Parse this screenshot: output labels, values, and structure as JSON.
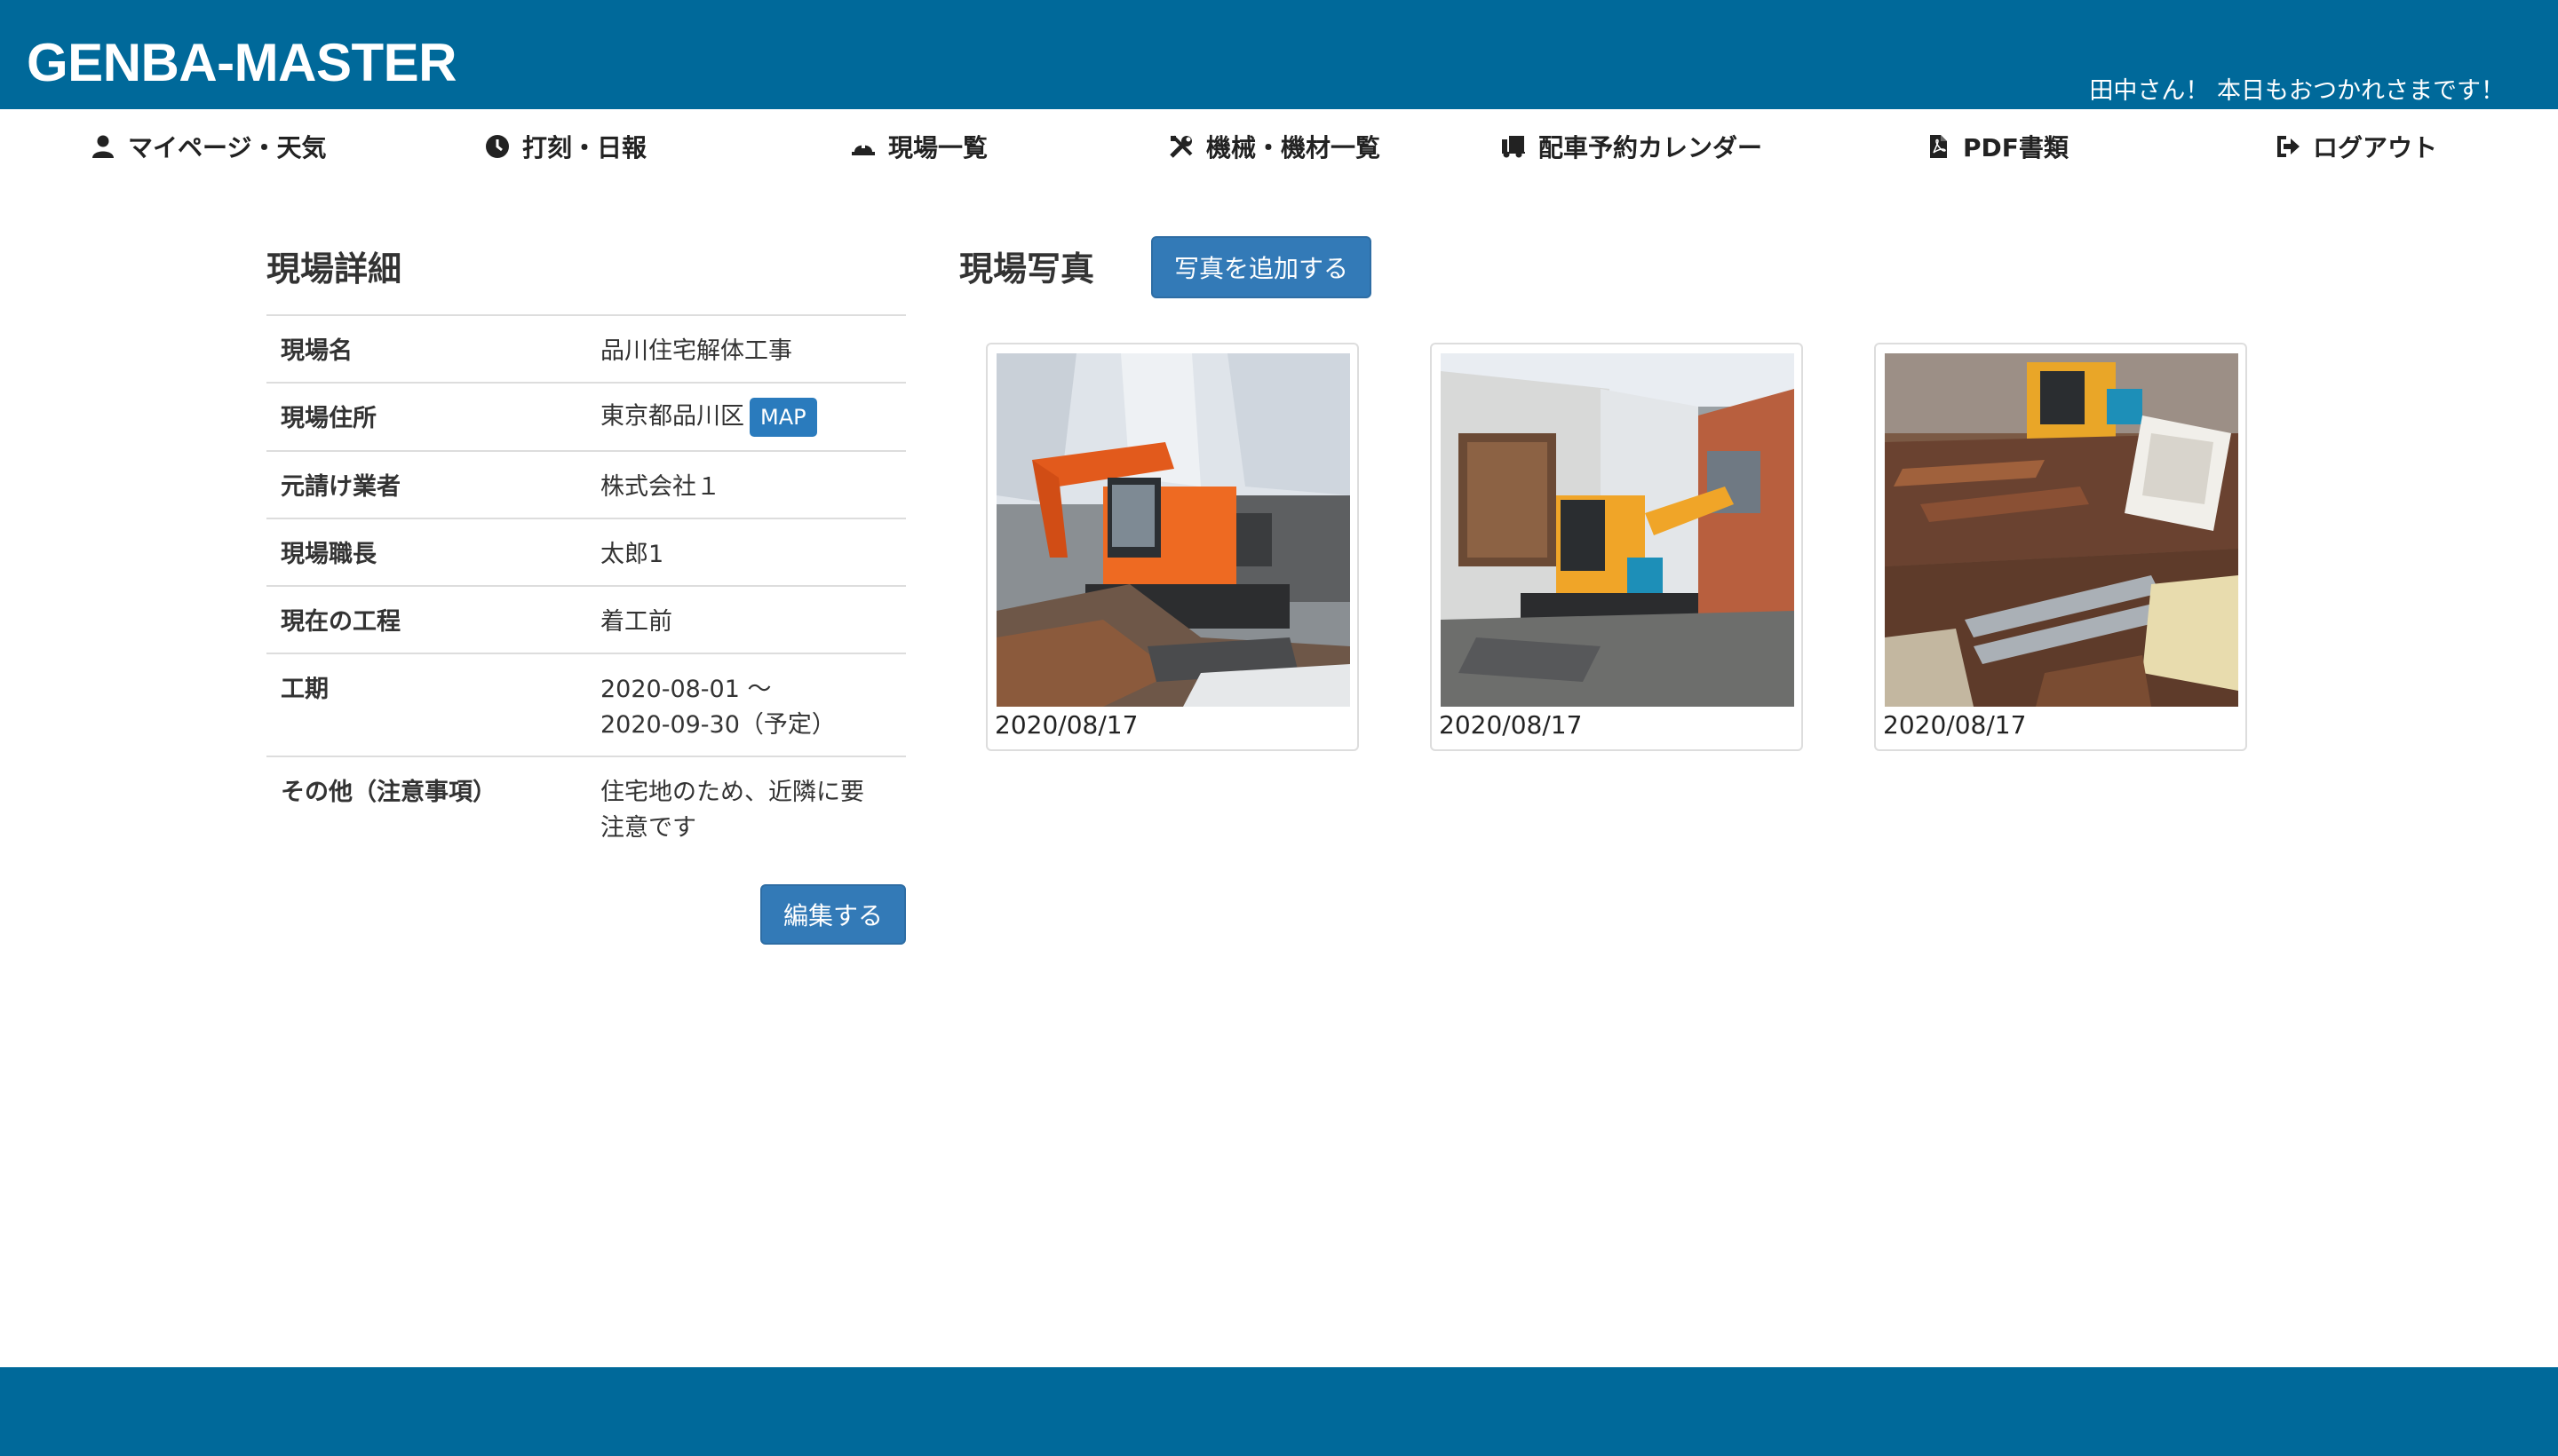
{
  "app": {
    "brand": "GENBA-MASTER",
    "greeting": "田中さん！ 本日もおつかれさまです！"
  },
  "nav": {
    "items": [
      {
        "label": "マイページ・天気",
        "icon": "user-icon"
      },
      {
        "label": "打刻・日報",
        "icon": "clock-icon"
      },
      {
        "label": "現場一覧",
        "icon": "hardhat-icon"
      },
      {
        "label": "機械・機材一覧",
        "icon": "tools-icon"
      },
      {
        "label": "配車予約カレンダー",
        "icon": "truck-icon"
      },
      {
        "label": "PDF書類",
        "icon": "pdf-file-icon"
      },
      {
        "label": "ログアウト",
        "icon": "logout-icon"
      }
    ]
  },
  "detail": {
    "title": "現場詳細",
    "rows": [
      {
        "key": "現場名",
        "value": "品川住宅解体工事"
      },
      {
        "key": "現場住所",
        "value": "東京都品川区",
        "button": "MAP"
      },
      {
        "key": "元請け業者",
        "value": "株式会社１"
      },
      {
        "key": "現場職長",
        "value": "太郎1"
      },
      {
        "key": "現在の工程",
        "value": "着工前"
      },
      {
        "key": "工期",
        "value_line1": "2020-08-01 〜",
        "value_line2": "2020-09-30（予定）"
      },
      {
        "key": "その他（注意事項）",
        "value_line1": "住宅地のため、近隣に要",
        "value_line2": "注意です"
      }
    ],
    "edit_button": "編集する"
  },
  "photos": {
    "title": "現場写真",
    "add_button": "写真を追加する",
    "items": [
      {
        "date": "2020/08/17",
        "subject": "orange-excavator-photo"
      },
      {
        "date": "2020/08/17",
        "subject": "yellow-mini-excavator-photo"
      },
      {
        "date": "2020/08/17",
        "subject": "demolition-debris-photo"
      }
    ]
  },
  "colors": {
    "header": "#00699a",
    "primary_button": "#337ab7",
    "map_button": "#2a7bbd"
  }
}
